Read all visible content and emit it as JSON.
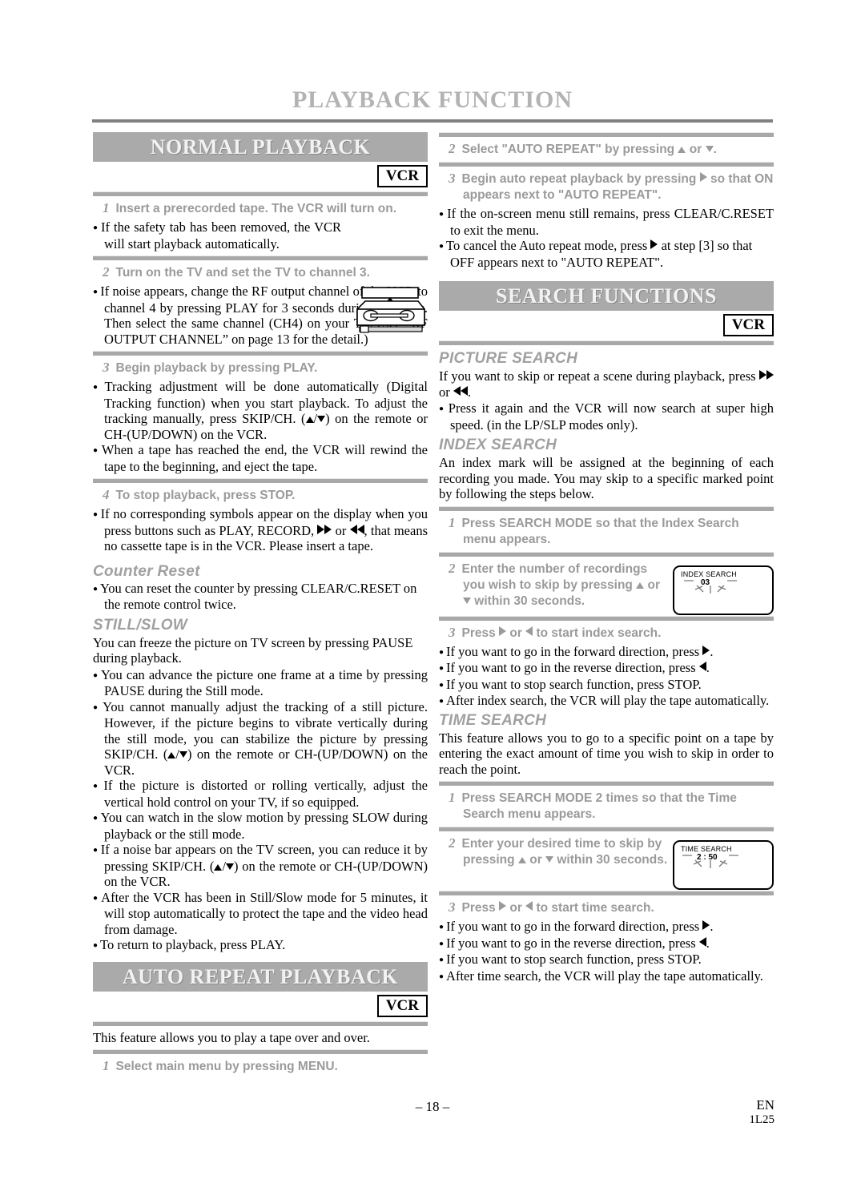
{
  "document": {
    "title": "PLAYBACK FUNCTION",
    "page_number": "– 18 –",
    "language_code": "EN",
    "doc_code": "1L25"
  },
  "badges": {
    "vcr": "VCR"
  },
  "sections": {
    "normal_playback": {
      "heading": "NORMAL PLAYBACK",
      "steps": [
        {
          "num": "1",
          "text": "Insert a prerecorded tape. The VCR will turn on."
        },
        {
          "num": "2",
          "text": "Turn on the TV and set the TV to channel 3."
        },
        {
          "num": "3",
          "text": "Begin playback by pressing PLAY."
        },
        {
          "num": "4",
          "text": "To stop playback, press STOP."
        }
      ],
      "step1_bullets": [
        "If the safety tab has been removed, the VCR will start playback automatically."
      ],
      "step2_bullets": [
        "If noise appears, change the RF output channel of the VCR to channel 4 by pressing PLAY for 3 seconds during playback. Then select the same channel (CH4) on your TV. (See “RF OUTPUT CHANNEL” on page 13 for the detail.)"
      ],
      "step3_bullets_a_pre": "Tracking adjustment will be done automatically (Digital Tracking function) when you start playback. To adjust the tracking manually, press SKIP/CH. (",
      "step3_bullets_a_post": ") on the remote or CH-(UP/DOWN) on the VCR.",
      "step3_bullets_b": "When a tape has reached the end, the VCR will rewind the tape to the beginning, and eject the tape.",
      "step4_bullet_pre": "If no corresponding symbols appear on the display when you press buttons such as PLAY, RECORD, ",
      "step4_bullet_mid": " or ",
      "step4_bullet_post": ", that means no cassette tape is in the VCR. Please insert a tape.",
      "counter_reset": {
        "heading": "Counter Reset",
        "bullet": "You can reset the counter by pressing CLEAR/C.RESET on the remote control twice."
      },
      "still_slow": {
        "heading": "STILL/SLOW",
        "intro": "You can freeze the picture on TV screen by pressing PAUSE during playback.",
        "bullets": [
          "You can advance the picture one frame at a time by pressing PAUSE during the Still mode.",
          "If the picture is distorted or rolling vertically, adjust the vertical hold control on your TV, if so equipped.",
          "You can watch in the slow motion by pressing SLOW during playback or the still mode.",
          "After the VCR has been in Still/Slow mode for 5 minutes, it will stop automatically to protect the tape and the video head from damage.",
          "To return to playback, press PLAY."
        ],
        "bullet_tracking_pre": "You cannot manually adjust the tracking of a still picture. However, if the picture begins to vibrate vertically during the still mode, you can stabilize the picture by pressing SKIP/CH. (",
        "bullet_tracking_post": ") on the remote or CH-(UP/DOWN) on the VCR.",
        "bullet_noise_pre": "If a noise bar appears on the TV screen, you can reduce it by pressing SKIP/CH. (",
        "bullet_noise_post": ") on the remote or CH-(UP/DOWN) on the VCR."
      }
    },
    "auto_repeat_playback": {
      "heading": "AUTO REPEAT PLAYBACK",
      "intro": "This feature allows you to play a tape over and over.",
      "step1": {
        "num": "1",
        "text": "Select main menu by pressing MENU."
      },
      "step2": {
        "num": "2",
        "pre": "Select \"AUTO REPEAT\" by pressing ",
        "mid": " or ",
        "post": "."
      },
      "step3": {
        "num": "3",
        "pre": "Begin auto repeat playback by pressing ",
        "post": " so that ON appears next to \"AUTO REPEAT\"."
      },
      "bullets": [
        "If the on-screen menu still remains, press CLEAR/C.RESET to exit the menu."
      ],
      "cancel_pre": "To cancel the Auto repeat mode, press ",
      "cancel_post": " at step [3] so that OFF appears next to \"AUTO REPEAT\"."
    },
    "search_functions": {
      "heading": "SEARCH FUNCTIONS",
      "picture_search": {
        "heading": "PICTURE SEARCH",
        "intro_pre": "If you want to skip or repeat a scene during playback, press ",
        "intro_mid": " or ",
        "intro_post": ".",
        "bullets": [
          "Press it again and the VCR will now search at super high speed. (in the LP/SLP modes only)."
        ]
      },
      "index_search": {
        "heading": "INDEX SEARCH",
        "intro": "An index mark will be assigned at the beginning of each recording you made. You may skip to a specific marked point by following the steps below.",
        "step1": {
          "num": "1",
          "text": "Press SEARCH MODE so that the Index Search menu appears."
        },
        "step2": {
          "num": "2",
          "pre": "Enter the number of recordings you wish to skip by pressing ",
          "mid": " or ",
          "post": " within 30 seconds."
        },
        "step3": {
          "num": "3",
          "pre": "Press ",
          "mid": " or ",
          "post": " to start index search."
        },
        "osd": {
          "label": "INDEX SEARCH",
          "value": "03"
        },
        "bullets_forward_pre": "If you want to go in the forward direction, press ",
        "bullets_reverse_pre": "If you want to go in the reverse direction, press ",
        "bullets_stop": "If you want to stop search function, press STOP.",
        "bullets_after": "After index search, the VCR will play the tape automatically."
      },
      "time_search": {
        "heading": "TIME SEARCH",
        "intro": "This feature allows you to go to a specific point on a tape by entering the exact amount of time you wish to skip in order to reach the point.",
        "step1": {
          "num": "1",
          "text": "Press SEARCH MODE 2 times so that the Time Search menu appears."
        },
        "step2": {
          "num": "2",
          "pre": "Enter your desired time to skip by pressing ",
          "mid": " or ",
          "post": " within 30 seconds."
        },
        "step3": {
          "num": "3",
          "pre": "Press ",
          "mid": " or ",
          "post": " to start time search."
        },
        "osd": {
          "label": "TIME SEARCH",
          "value": "2 : 50"
        },
        "bullets_forward_pre": "If you want to go in the forward direction, press ",
        "bullets_reverse_pre": "If you want to go in the reverse direction, press ",
        "bullets_stop": "If you want to stop search function, press STOP.",
        "bullets_after": "After time search, the VCR will play the tape automatically."
      }
    }
  },
  "colors": {
    "banner_bg": "#aaaaaa",
    "heading_gray": "#b3b3b3",
    "step_gray": "#9a9a9a",
    "rule_gray": "#a8a8a8"
  }
}
